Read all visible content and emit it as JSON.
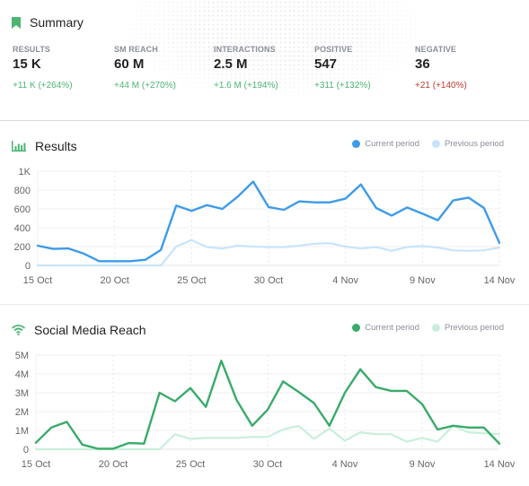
{
  "summary": {
    "title": "Summary",
    "icon": "bookmark-icon",
    "metrics": [
      {
        "label": "RESULTS",
        "value": "15 K",
        "delta": "+11 K",
        "pct": "(+264%)",
        "trend": "up"
      },
      {
        "label": "SM REACH",
        "value": "60 M",
        "delta": "+44 M",
        "pct": "(+270%)",
        "trend": "up"
      },
      {
        "label": "INTERACTIONS",
        "value": "2.5 M",
        "delta": "+1.6 M",
        "pct": "(+194%)",
        "trend": "up"
      },
      {
        "label": "POSITIVE",
        "value": "547",
        "delta": "+311",
        "pct": "(+132%)",
        "trend": "up"
      },
      {
        "label": "NEGATIVE",
        "value": "36",
        "delta": "+21",
        "pct": "(+140%)",
        "trend": "down"
      }
    ]
  },
  "colors": {
    "accent_green": "#4cb572",
    "positive_text": "#4cb572",
    "negative_text": "#c0392b",
    "results_current": "#3d9be9",
    "results_previous": "#c8e4fb",
    "reach_current": "#3aaa6a",
    "reach_previous": "#c9efdc"
  },
  "chart_data": [
    {
      "type": "line",
      "title": "Results",
      "icon": "bar-chart-icon",
      "xlabel": "",
      "ylabel": "",
      "ylim": [
        0,
        1000
      ],
      "yticks": [
        "0",
        "200",
        "400",
        "600",
        "800",
        "1K"
      ],
      "ytick_values": [
        0,
        200,
        400,
        600,
        800,
        1000
      ],
      "xticks": [
        "15 Oct",
        "20 Oct",
        "25 Oct",
        "30 Oct",
        "4 Nov",
        "9 Nov",
        "14 Nov"
      ],
      "xtick_index": [
        0,
        5,
        10,
        15,
        20,
        25,
        30
      ],
      "grid": true,
      "legend_position": "top-right",
      "x": [
        "15 Oct",
        "16 Oct",
        "17 Oct",
        "18 Oct",
        "19 Oct",
        "20 Oct",
        "21 Oct",
        "22 Oct",
        "23 Oct",
        "24 Oct",
        "25 Oct",
        "26 Oct",
        "27 Oct",
        "28 Oct",
        "29 Oct",
        "30 Oct",
        "31 Oct",
        "1 Nov",
        "2 Nov",
        "3 Nov",
        "4 Nov",
        "5 Nov",
        "6 Nov",
        "7 Nov",
        "8 Nov",
        "9 Nov",
        "10 Nov",
        "11 Nov",
        "12 Nov",
        "13 Nov",
        "14 Nov"
      ],
      "series": [
        {
          "name": "Current period",
          "values": [
            210,
            175,
            180,
            125,
            45,
            45,
            45,
            60,
            165,
            635,
            580,
            640,
            600,
            730,
            890,
            620,
            590,
            680,
            670,
            670,
            710,
            860,
            610,
            530,
            615,
            550,
            480,
            690,
            720,
            610,
            240
          ]
        },
        {
          "name": "Previous period",
          "values": [
            0,
            0,
            0,
            0,
            0,
            0,
            0,
            0,
            0,
            200,
            270,
            195,
            180,
            210,
            200,
            195,
            195,
            210,
            230,
            235,
            200,
            180,
            195,
            155,
            195,
            205,
            190,
            160,
            155,
            160,
            190
          ]
        }
      ]
    },
    {
      "type": "line",
      "title": "Social Media Reach",
      "icon": "wifi-icon",
      "xlabel": "",
      "ylabel": "",
      "ylim": [
        0,
        5000000
      ],
      "yticks": [
        "0",
        "1M",
        "2M",
        "3M",
        "4M",
        "5M"
      ],
      "ytick_values": [
        0,
        1000000,
        2000000,
        3000000,
        4000000,
        5000000
      ],
      "xticks": [
        "15 Oct",
        "20 Oct",
        "25 Oct",
        "30 Oct",
        "4 Nov",
        "9 Nov",
        "14 Nov"
      ],
      "xtick_index": [
        0,
        5,
        10,
        15,
        20,
        25,
        30
      ],
      "grid": true,
      "legend_position": "top-right",
      "x": [
        "15 Oct",
        "16 Oct",
        "17 Oct",
        "18 Oct",
        "19 Oct",
        "20 Oct",
        "21 Oct",
        "22 Oct",
        "23 Oct",
        "24 Oct",
        "25 Oct",
        "26 Oct",
        "27 Oct",
        "28 Oct",
        "29 Oct",
        "30 Oct",
        "31 Oct",
        "1 Nov",
        "2 Nov",
        "3 Nov",
        "4 Nov",
        "5 Nov",
        "6 Nov",
        "7 Nov",
        "8 Nov",
        "9 Nov",
        "10 Nov",
        "11 Nov",
        "12 Nov",
        "13 Nov",
        "14 Nov"
      ],
      "series": [
        {
          "name": "Current period",
          "values": [
            350000,
            1150000,
            1450000,
            250000,
            30000,
            30000,
            330000,
            300000,
            3000000,
            2550000,
            3250000,
            2250000,
            4700000,
            2600000,
            1250000,
            2100000,
            3600000,
            3050000,
            2450000,
            1250000,
            3000000,
            4250000,
            3300000,
            3100000,
            3100000,
            2400000,
            1050000,
            1250000,
            1150000,
            1150000,
            300000
          ]
        },
        {
          "name": "Previous period",
          "values": [
            0,
            0,
            0,
            0,
            0,
            0,
            0,
            0,
            0,
            800000,
            550000,
            600000,
            600000,
            600000,
            650000,
            650000,
            1050000,
            1250000,
            550000,
            1100000,
            450000,
            900000,
            800000,
            800000,
            400000,
            600000,
            400000,
            1250000,
            900000,
            850000,
            800000
          ]
        }
      ]
    }
  ]
}
